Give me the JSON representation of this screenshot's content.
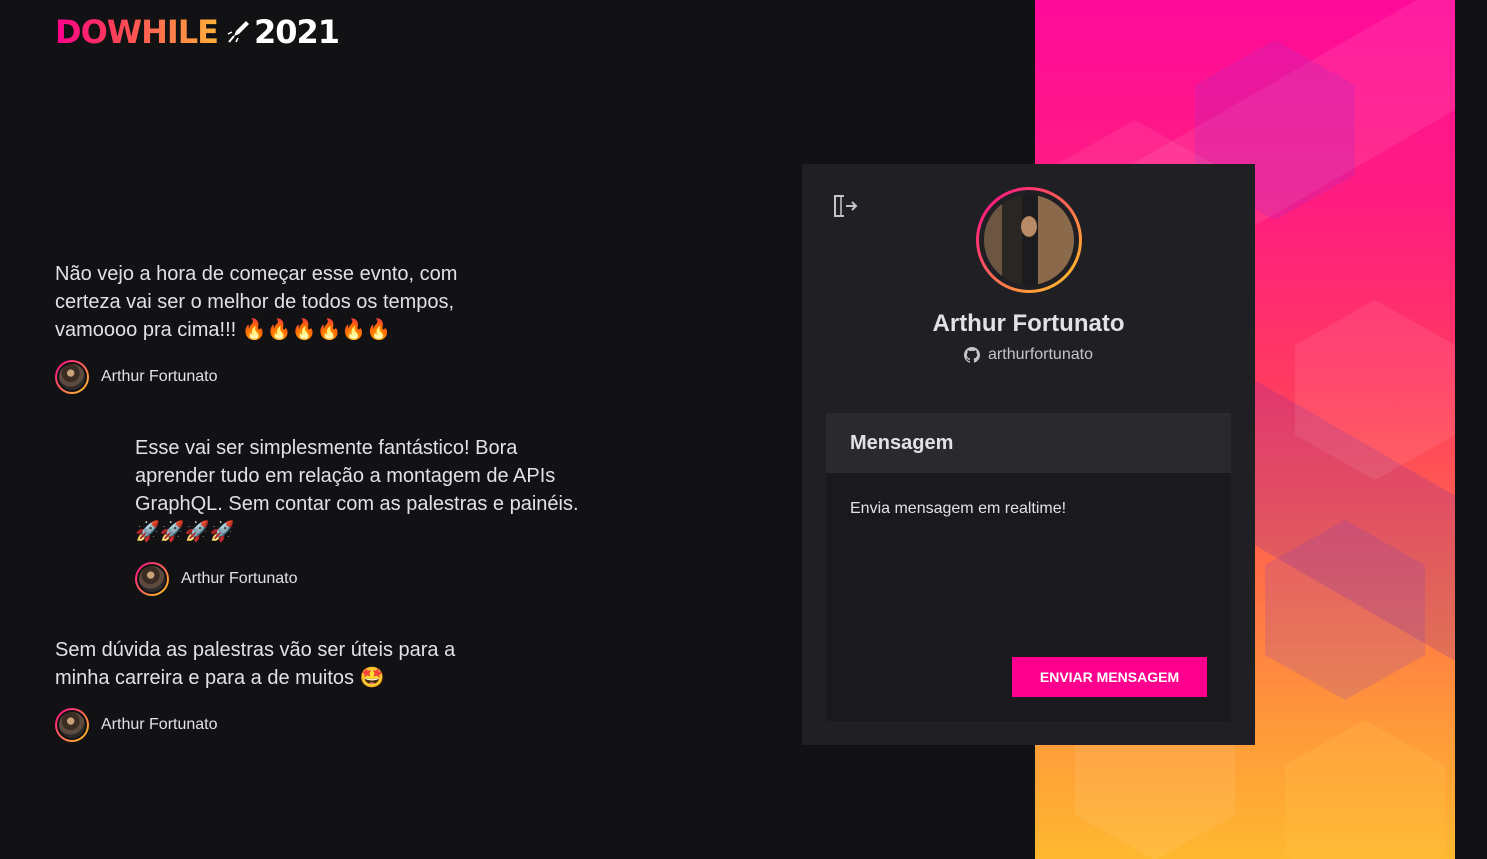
{
  "logo": {
    "word": "DOWHILE",
    "year": "2021"
  },
  "messages": [
    {
      "text": "Não vejo a hora de começar esse evnto, com certeza vai ser o melhor de todos os tempos, vamoooo pra cima!!! 🔥🔥🔥🔥🔥🔥",
      "author": "Arthur Fortunato"
    },
    {
      "text": "Esse vai ser simplesmente fantástico! Bora aprender tudo em relação a montagem de APIs GraphQL. Sem contar com as palestras e painéis. 🚀🚀🚀🚀",
      "author": "Arthur Fortunato"
    },
    {
      "text": "Sem dúvida as palestras vão ser úteis para a minha carreira e para a de muitos 🤩",
      "author": "Arthur Fortunato"
    }
  ],
  "profile": {
    "name": "Arthur Fortunato",
    "github": "arthurfortunato"
  },
  "form": {
    "title": "Mensagem",
    "message_value": "Envia mensagem em realtime!",
    "submit_label": "ENVIAR MENSAGEM"
  },
  "colors": {
    "background": "#121214",
    "card": "#202024",
    "accent": "#ff008e",
    "gradient_end": "#ffcd1e"
  }
}
